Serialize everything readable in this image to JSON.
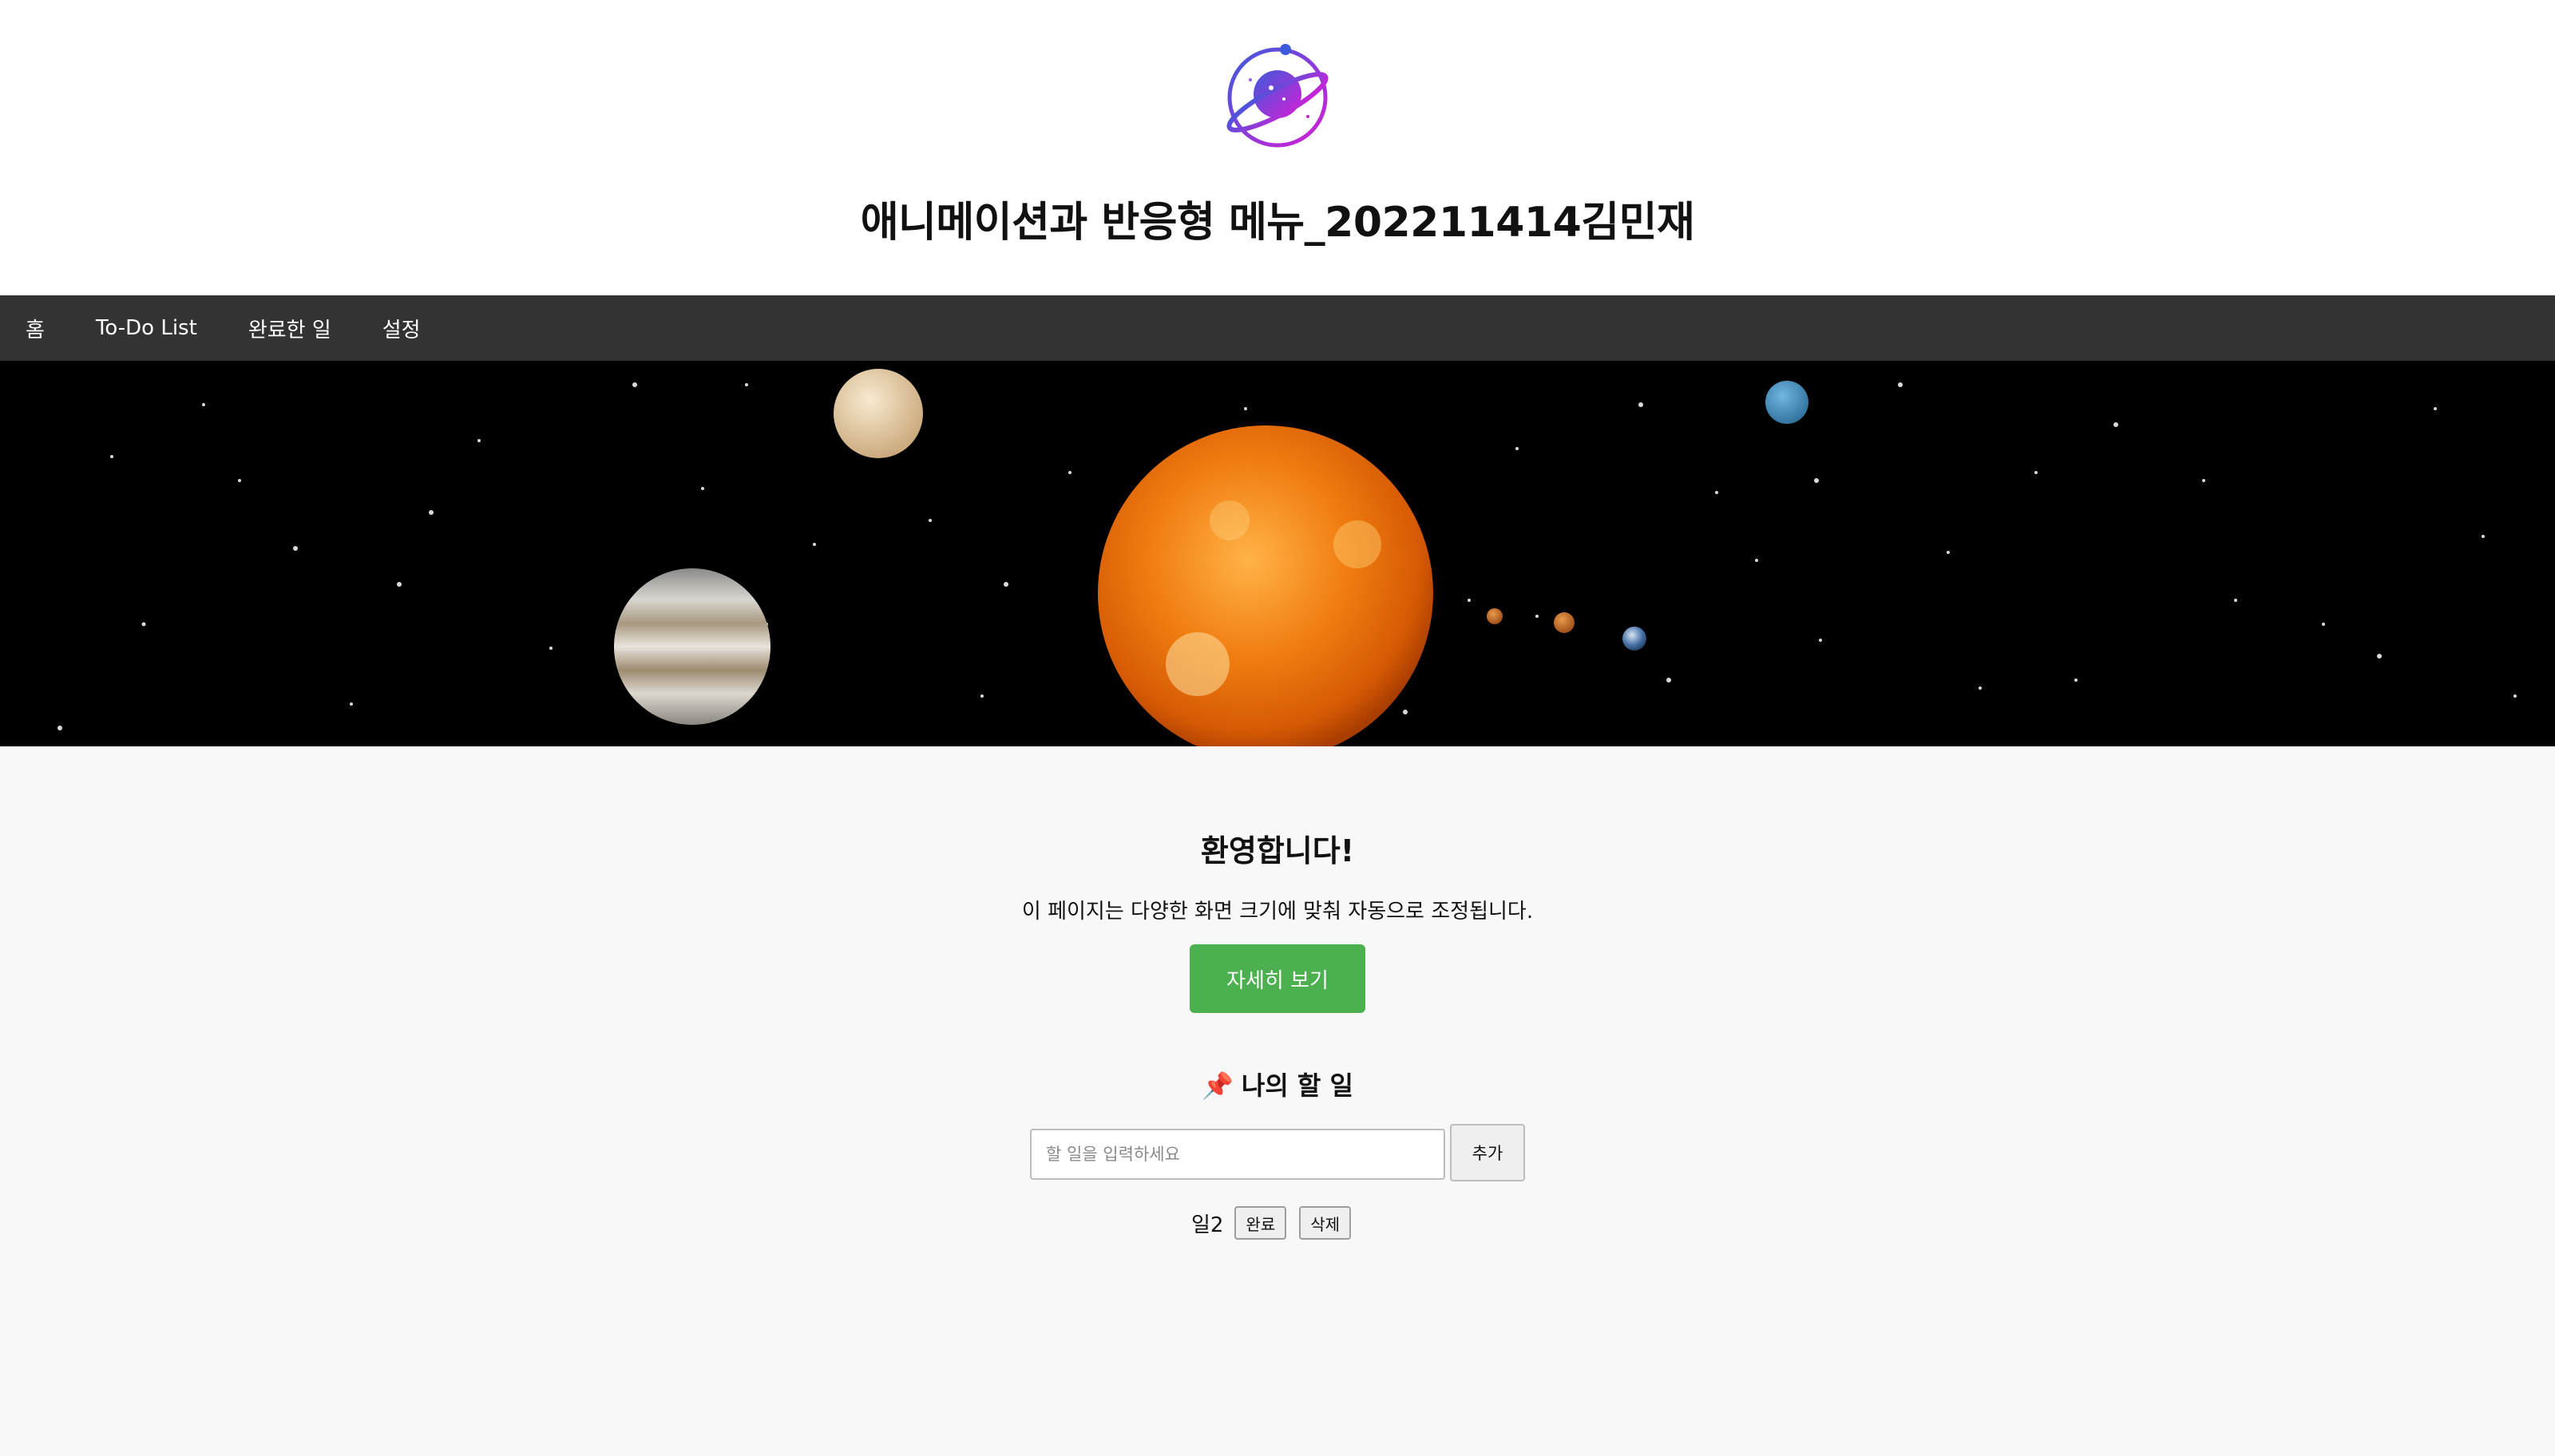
{
  "header": {
    "logo_icon": "planet-logo-icon",
    "title": "애니메이션과 반응형 메뉴_202211414김민재"
  },
  "nav": {
    "items": [
      {
        "label": "홈"
      },
      {
        "label": "To-Do List"
      },
      {
        "label": "완료한 일"
      },
      {
        "label": "설정"
      }
    ]
  },
  "banner": {
    "image": "solar-system-image"
  },
  "main": {
    "welcome_title": "환영합니다!",
    "welcome_text": "이 페이지는 다양한 화면 크기에 맞춰 자동으로 조정됩니다.",
    "more_button": "자세히 보기"
  },
  "todo": {
    "pin_icon": "📌",
    "title": "나의 할 일",
    "input_placeholder": "할 일을 입력하세요",
    "input_value": "",
    "add_button": "추가",
    "items": [
      {
        "text": "일2",
        "complete_label": "완료",
        "delete_label": "삭제"
      }
    ]
  },
  "colors": {
    "nav_bg": "#333333",
    "accent_green": "#4caf50",
    "logo_gradient_start": "#3b5bdb",
    "logo_gradient_end": "#d61fd6"
  }
}
